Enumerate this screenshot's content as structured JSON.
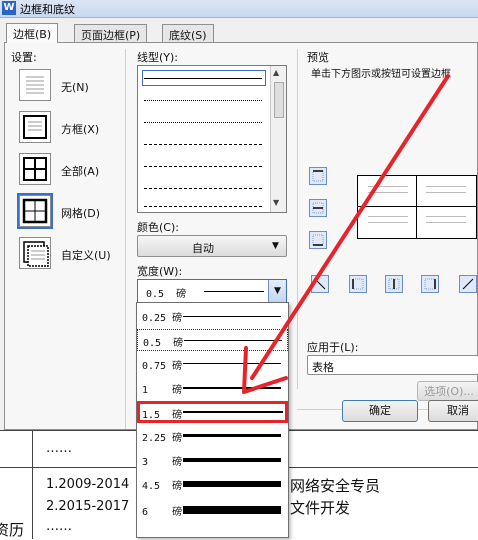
{
  "window": {
    "title": "边框和底纹",
    "app_icon": "W"
  },
  "tabs": [
    {
      "label": "边框(B)",
      "active": true
    },
    {
      "label": "页面边框(P)",
      "active": false
    },
    {
      "label": "底纹(S)",
      "active": false
    }
  ],
  "settings": {
    "label": "设置:",
    "items": [
      {
        "label": "无(N)"
      },
      {
        "label": "方框(X)"
      },
      {
        "label": "全部(A)"
      },
      {
        "label": "网格(D)",
        "selected": true
      },
      {
        "label": "自定义(U)"
      }
    ]
  },
  "line_style": {
    "label": "线型(Y):"
  },
  "color": {
    "label": "颜色(C):",
    "value": "自动"
  },
  "width": {
    "label": "宽度(W):",
    "value": "0.5  磅"
  },
  "width_options": [
    {
      "label": "0.25 磅",
      "points": 0.25
    },
    {
      "label": "0.5  磅",
      "points": 0.5
    },
    {
      "label": "0.75 磅",
      "points": 0.75
    },
    {
      "label": "1    磅",
      "points": 1
    },
    {
      "label": "1.5  磅",
      "points": 1.5,
      "highlighted": true
    },
    {
      "label": "2.25 磅",
      "points": 2.25
    },
    {
      "label": "3    磅",
      "points": 3
    },
    {
      "label": "4.5  磅",
      "points": 4.5
    },
    {
      "label": "6    磅",
      "points": 6
    }
  ],
  "preview": {
    "label": "预览",
    "hint": "单击下方图示或按钮可设置边框"
  },
  "apply_to": {
    "label": "应用于(L):",
    "value": "表格"
  },
  "buttons": {
    "options": "选项(O)...",
    "ok": "确定",
    "cancel": "取消"
  },
  "document": {
    "lines": [
      "……",
      "1.2009-2014",
      "2.2015-2017",
      "……",
      "网络安全专员",
      "文件开发",
      "资历"
    ]
  },
  "colors": {
    "accent": "#3b6fc5",
    "annotation": "#e8232a"
  }
}
